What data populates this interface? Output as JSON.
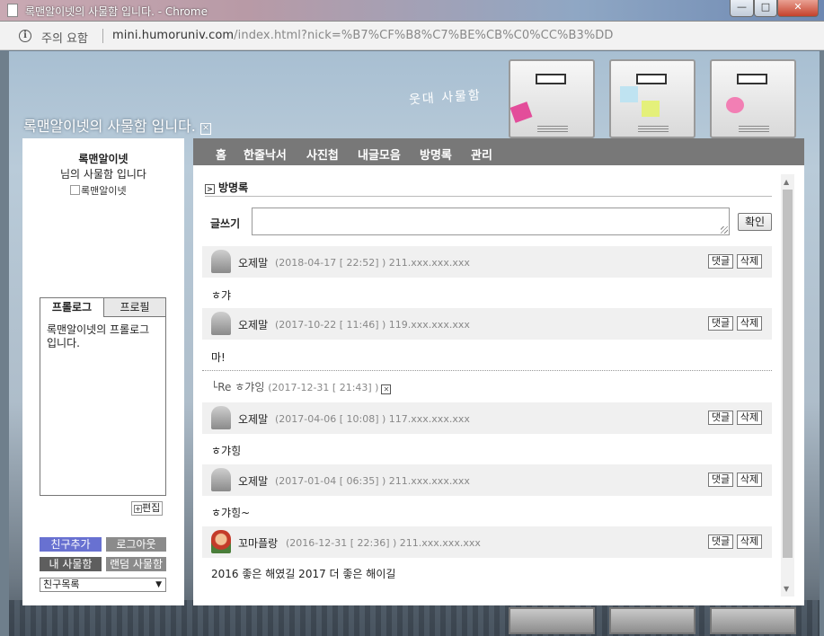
{
  "window": {
    "title": "록맨알이넷의 사물함 입니다. - Chrome",
    "minimize": "—",
    "maximize": "□",
    "close": "✕"
  },
  "address": {
    "security": "주의 요함",
    "host": "mini.humoruniv.com",
    "path": "/index.html?nick=%B7%CF%B8%C7%BE%CB%C0%CC%B3%DD"
  },
  "site": {
    "title": "록맨알이넷의 사물함 입니다.",
    "logo": "웃대  사물함"
  },
  "owner": {
    "name": "록맨알이넷",
    "subtitle": "님의 사물함 입니다",
    "image_alt": "록맨알이넷"
  },
  "profile": {
    "tabs": [
      "프롤로그",
      "프로필"
    ],
    "prolog_text": "록맨알이넷의 프롤로그 입니다.",
    "edit_label": "편집"
  },
  "left_buttons": {
    "add_friend": "친구추가",
    "logout": "로그아웃",
    "my_box": "내 사물함",
    "random_box": "랜덤 사물함",
    "friend_list": "친구목록"
  },
  "menu": [
    "홈",
    "한줄낙서",
    "사진첩",
    "내글모음",
    "방명록",
    "관리"
  ],
  "guestbook": {
    "title": "방명록",
    "write_label": "글쓰기",
    "confirm": "확인",
    "reply_btn": "댓글",
    "delete_btn": "삭제",
    "entries": [
      {
        "name": "오제말",
        "meta": "(2018-04-17 [ 22:52] ) 211.xxx.xxx.xxx",
        "body": "ㅎ갸"
      },
      {
        "name": "오제말",
        "meta": "(2017-10-22 [ 11:46] ) 119.xxx.xxx.xxx",
        "body": "마!"
      },
      {
        "name": "오제말",
        "meta": "(2017-04-06 [ 10:08] ) 117.xxx.xxx.xxx",
        "body": "ㅎ갸힝"
      },
      {
        "name": "오제말",
        "meta": "(2017-01-04 [ 06:35] ) 211.xxx.xxx.xxx",
        "body": "ㅎ갸힝~"
      },
      {
        "name": "꼬마플랑",
        "meta": "(2016-12-31 [ 22:36] ) 211.xxx.xxx.xxx",
        "body": "2016 좋은 해였길 2017 더 좋은 해이길"
      }
    ],
    "reply": {
      "prefix": "└Re",
      "text": "ㅎ갸잉",
      "meta": "(2017-12-31 [ 21:43] )"
    }
  }
}
